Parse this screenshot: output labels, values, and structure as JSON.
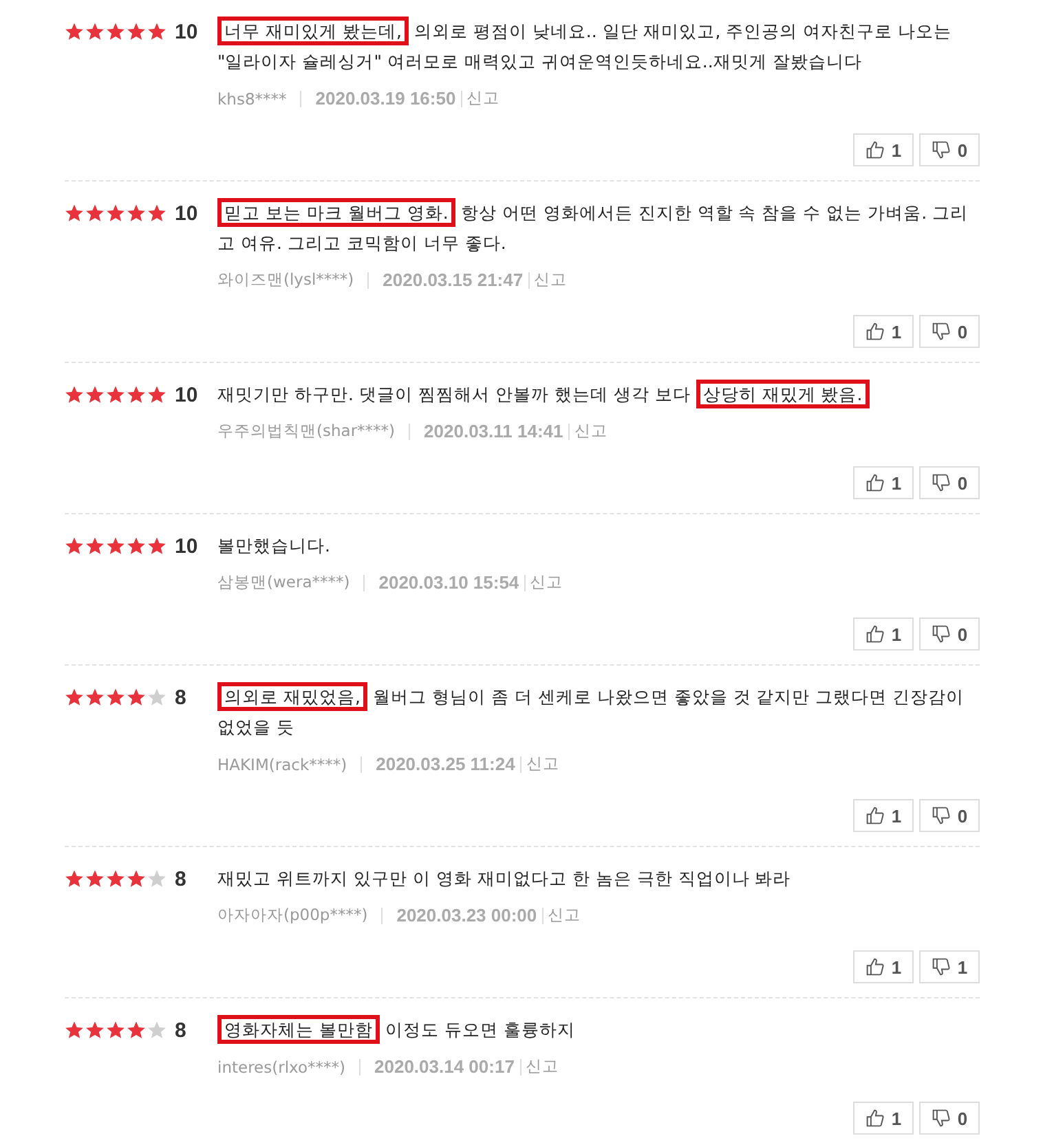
{
  "reviews": [
    {
      "stars": 5,
      "score": "10",
      "segments": [
        {
          "text": "너무 재미있게 봤는데,",
          "boxed": true
        },
        {
          "text": "의외로 평점이 낮네요.. 일단 재미있고, 주인공의 여자친구로 나오는 \"일라이자 슐레싱거\" 여러모로 매력있고 귀여운역인듯하네요..재밋게 잘봤습니다",
          "boxed": false
        }
      ],
      "user": "khs8****",
      "date": "2020.03.19 16:50",
      "report": "신고",
      "likes": "1",
      "dislikes": "0"
    },
    {
      "stars": 5,
      "score": "10",
      "segments": [
        {
          "text": "믿고 보는 마크 월버그 영화.",
          "boxed": true
        },
        {
          "text": "항상 어떤 영화에서든 진지한 역할 속 참을 수 없는 가벼움. 그리고 여유. 그리고 코믹함이 너무 좋다.",
          "boxed": false
        }
      ],
      "user": "와이즈맨(lysl****)",
      "date": "2020.03.15 21:47",
      "report": "신고",
      "likes": "1",
      "dislikes": "0"
    },
    {
      "stars": 5,
      "score": "10",
      "segments": [
        {
          "text": "재밋기만 하구만. 댓글이 찜찜해서 안볼까 했는데 생각 보다",
          "boxed": false
        },
        {
          "text": "상당히 재밌게 봤음.",
          "boxed": true
        }
      ],
      "user": "우주의법칙맨(shar****)",
      "date": "2020.03.11 14:41",
      "report": "신고",
      "likes": "1",
      "dislikes": "0"
    },
    {
      "stars": 5,
      "score": "10",
      "segments": [
        {
          "text": "볼만했습니다.",
          "boxed": false
        }
      ],
      "user": "삼봉맨(wera****)",
      "date": "2020.03.10 15:54",
      "report": "신고",
      "likes": "1",
      "dislikes": "0"
    },
    {
      "stars": 4,
      "score": "8",
      "segments": [
        {
          "text": "의외로 재밌었음,",
          "boxed": true
        },
        {
          "text": "월버그 형님이 좀 더 센케로 나왔으면 좋았을 것 같지만 그랬다면 긴장감이 없었을 듯",
          "boxed": false
        }
      ],
      "user": "HAKIM(rack****)",
      "date": "2020.03.25 11:24",
      "report": "신고",
      "likes": "1",
      "dislikes": "0"
    },
    {
      "stars": 4,
      "score": "8",
      "segments": [
        {
          "text": "재밌고 위트까지 있구만 이 영화 재미없다고 한 놈은 극한 직업이나 봐라",
          "boxed": false
        }
      ],
      "user": "아자아자(p00p****)",
      "date": "2020.03.23 00:00",
      "report": "신고",
      "likes": "1",
      "dislikes": "1"
    },
    {
      "stars": 4,
      "score": "8",
      "segments": [
        {
          "text": "영화자체는 볼만함",
          "boxed": true
        },
        {
          "text": "이정도 듀오면 훌륭하지",
          "boxed": false
        }
      ],
      "user": "interes(rlxo****)",
      "date": "2020.03.14 00:17",
      "report": "신고",
      "likes": "1",
      "dislikes": "0"
    }
  ]
}
